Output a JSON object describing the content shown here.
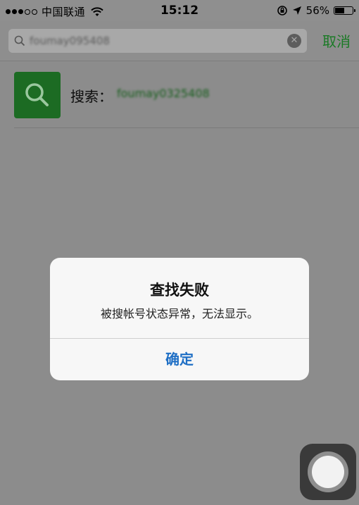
{
  "status_bar": {
    "carrier": "中国联通",
    "time": "15:12",
    "battery_percent": "56%",
    "battery_level": 0.56,
    "signal_bars_filled": 3,
    "signal_bars_total": 5
  },
  "search": {
    "query": "foumay095408",
    "cancel_label": "取消",
    "clear_icon": "clear-icon",
    "search_icon": "search-icon"
  },
  "result": {
    "label": "搜索：",
    "query": "foumay0325408",
    "icon": "search-icon"
  },
  "alert": {
    "title": "查找失败",
    "message": "被搜帐号状态异常，无法显示。",
    "button_label": "确定"
  },
  "colors": {
    "accent_green": "#1a7a25",
    "alert_button_blue": "#1f6fc5"
  }
}
